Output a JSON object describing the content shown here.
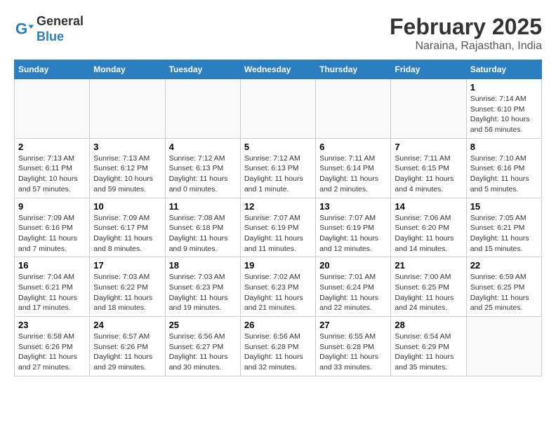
{
  "header": {
    "logo_general": "General",
    "logo_blue": "Blue",
    "month_title": "February 2025",
    "location": "Naraina, Rajasthan, India"
  },
  "days_of_week": [
    "Sunday",
    "Monday",
    "Tuesday",
    "Wednesday",
    "Thursday",
    "Friday",
    "Saturday"
  ],
  "weeks": [
    [
      {
        "day": "",
        "info": ""
      },
      {
        "day": "",
        "info": ""
      },
      {
        "day": "",
        "info": ""
      },
      {
        "day": "",
        "info": ""
      },
      {
        "day": "",
        "info": ""
      },
      {
        "day": "",
        "info": ""
      },
      {
        "day": "1",
        "info": "Sunrise: 7:14 AM\nSunset: 6:10 PM\nDaylight: 10 hours\nand 56 minutes."
      }
    ],
    [
      {
        "day": "2",
        "info": "Sunrise: 7:13 AM\nSunset: 6:11 PM\nDaylight: 10 hours\nand 57 minutes."
      },
      {
        "day": "3",
        "info": "Sunrise: 7:13 AM\nSunset: 6:12 PM\nDaylight: 10 hours\nand 59 minutes."
      },
      {
        "day": "4",
        "info": "Sunrise: 7:12 AM\nSunset: 6:13 PM\nDaylight: 11 hours\nand 0 minutes."
      },
      {
        "day": "5",
        "info": "Sunrise: 7:12 AM\nSunset: 6:13 PM\nDaylight: 11 hours\nand 1 minute."
      },
      {
        "day": "6",
        "info": "Sunrise: 7:11 AM\nSunset: 6:14 PM\nDaylight: 11 hours\nand 2 minutes."
      },
      {
        "day": "7",
        "info": "Sunrise: 7:11 AM\nSunset: 6:15 PM\nDaylight: 11 hours\nand 4 minutes."
      },
      {
        "day": "8",
        "info": "Sunrise: 7:10 AM\nSunset: 6:16 PM\nDaylight: 11 hours\nand 5 minutes."
      }
    ],
    [
      {
        "day": "9",
        "info": "Sunrise: 7:09 AM\nSunset: 6:16 PM\nDaylight: 11 hours\nand 7 minutes."
      },
      {
        "day": "10",
        "info": "Sunrise: 7:09 AM\nSunset: 6:17 PM\nDaylight: 11 hours\nand 8 minutes."
      },
      {
        "day": "11",
        "info": "Sunrise: 7:08 AM\nSunset: 6:18 PM\nDaylight: 11 hours\nand 9 minutes."
      },
      {
        "day": "12",
        "info": "Sunrise: 7:07 AM\nSunset: 6:19 PM\nDaylight: 11 hours\nand 11 minutes."
      },
      {
        "day": "13",
        "info": "Sunrise: 7:07 AM\nSunset: 6:19 PM\nDaylight: 11 hours\nand 12 minutes."
      },
      {
        "day": "14",
        "info": "Sunrise: 7:06 AM\nSunset: 6:20 PM\nDaylight: 11 hours\nand 14 minutes."
      },
      {
        "day": "15",
        "info": "Sunrise: 7:05 AM\nSunset: 6:21 PM\nDaylight: 11 hours\nand 15 minutes."
      }
    ],
    [
      {
        "day": "16",
        "info": "Sunrise: 7:04 AM\nSunset: 6:21 PM\nDaylight: 11 hours\nand 17 minutes."
      },
      {
        "day": "17",
        "info": "Sunrise: 7:03 AM\nSunset: 6:22 PM\nDaylight: 11 hours\nand 18 minutes."
      },
      {
        "day": "18",
        "info": "Sunrise: 7:03 AM\nSunset: 6:23 PM\nDaylight: 11 hours\nand 19 minutes."
      },
      {
        "day": "19",
        "info": "Sunrise: 7:02 AM\nSunset: 6:23 PM\nDaylight: 11 hours\nand 21 minutes."
      },
      {
        "day": "20",
        "info": "Sunrise: 7:01 AM\nSunset: 6:24 PM\nDaylight: 11 hours\nand 22 minutes."
      },
      {
        "day": "21",
        "info": "Sunrise: 7:00 AM\nSunset: 6:25 PM\nDaylight: 11 hours\nand 24 minutes."
      },
      {
        "day": "22",
        "info": "Sunrise: 6:59 AM\nSunset: 6:25 PM\nDaylight: 11 hours\nand 25 minutes."
      }
    ],
    [
      {
        "day": "23",
        "info": "Sunrise: 6:58 AM\nSunset: 6:26 PM\nDaylight: 11 hours\nand 27 minutes."
      },
      {
        "day": "24",
        "info": "Sunrise: 6:57 AM\nSunset: 6:26 PM\nDaylight: 11 hours\nand 29 minutes."
      },
      {
        "day": "25",
        "info": "Sunrise: 6:56 AM\nSunset: 6:27 PM\nDaylight: 11 hours\nand 30 minutes."
      },
      {
        "day": "26",
        "info": "Sunrise: 6:56 AM\nSunset: 6:28 PM\nDaylight: 11 hours\nand 32 minutes."
      },
      {
        "day": "27",
        "info": "Sunrise: 6:55 AM\nSunset: 6:28 PM\nDaylight: 11 hours\nand 33 minutes."
      },
      {
        "day": "28",
        "info": "Sunrise: 6:54 AM\nSunset: 6:29 PM\nDaylight: 11 hours\nand 35 minutes."
      },
      {
        "day": "",
        "info": ""
      }
    ]
  ]
}
